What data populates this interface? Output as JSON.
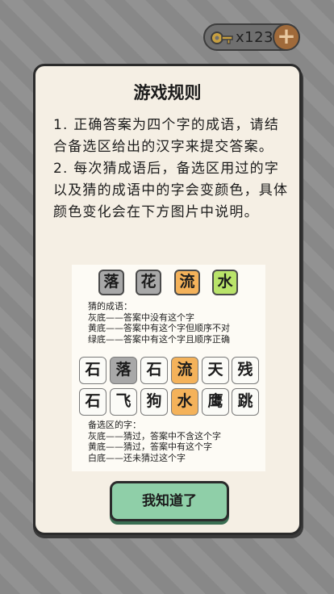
{
  "currency": {
    "count": "x123",
    "plus": "+"
  },
  "dialog": {
    "title": "游戏规则",
    "rule1": "1. 正确答案为四个字的成语，请结合备选区给出的汉字来提交答案。",
    "rule2": "2. 每次猜成语后，备选区用过的字以及猜的成语中的字会变颜色，具体颜色变化会在下方图片中说明。",
    "guess_tiles": [
      {
        "char": "落",
        "color": "gray"
      },
      {
        "char": "花",
        "color": "gray"
      },
      {
        "char": "流",
        "color": "yellow"
      },
      {
        "char": "水",
        "color": "green"
      }
    ],
    "guess_legend": {
      "heading": "猜的成语：",
      "gray": "灰底——答案中没有这个字",
      "yellow": "黄底——答案中有这个字但顺序不对",
      "green": "绿底——答案中有这个字且顺序正确"
    },
    "pool_rows": [
      [
        {
          "char": "石",
          "color": "white"
        },
        {
          "char": "落",
          "color": "gray"
        },
        {
          "char": "石",
          "color": "white"
        },
        {
          "char": "流",
          "color": "yellow"
        },
        {
          "char": "天",
          "color": "white"
        },
        {
          "char": "残",
          "color": "white"
        }
      ],
      [
        {
          "char": "石",
          "color": "white"
        },
        {
          "char": "飞",
          "color": "white"
        },
        {
          "char": "狗",
          "color": "white"
        },
        {
          "char": "水",
          "color": "yellow"
        },
        {
          "char": "鹰",
          "color": "white"
        },
        {
          "char": "跳",
          "color": "white"
        }
      ]
    ],
    "pool_legend": {
      "heading": "备选区的字：",
      "gray": "灰底——猜过，答案中不含这个字",
      "yellow": "黄底——猜过，答案中有这个字",
      "white": "白底——还未猜过这个字"
    },
    "confirm_label": "我知道了"
  },
  "colors": {
    "gray": "#a8a8a8",
    "yellow": "#f4b25a",
    "green": "#b9e36a",
    "white": "#fbfbf7",
    "button": "#8fcfa8",
    "dialog_bg": "#f5efe4"
  }
}
